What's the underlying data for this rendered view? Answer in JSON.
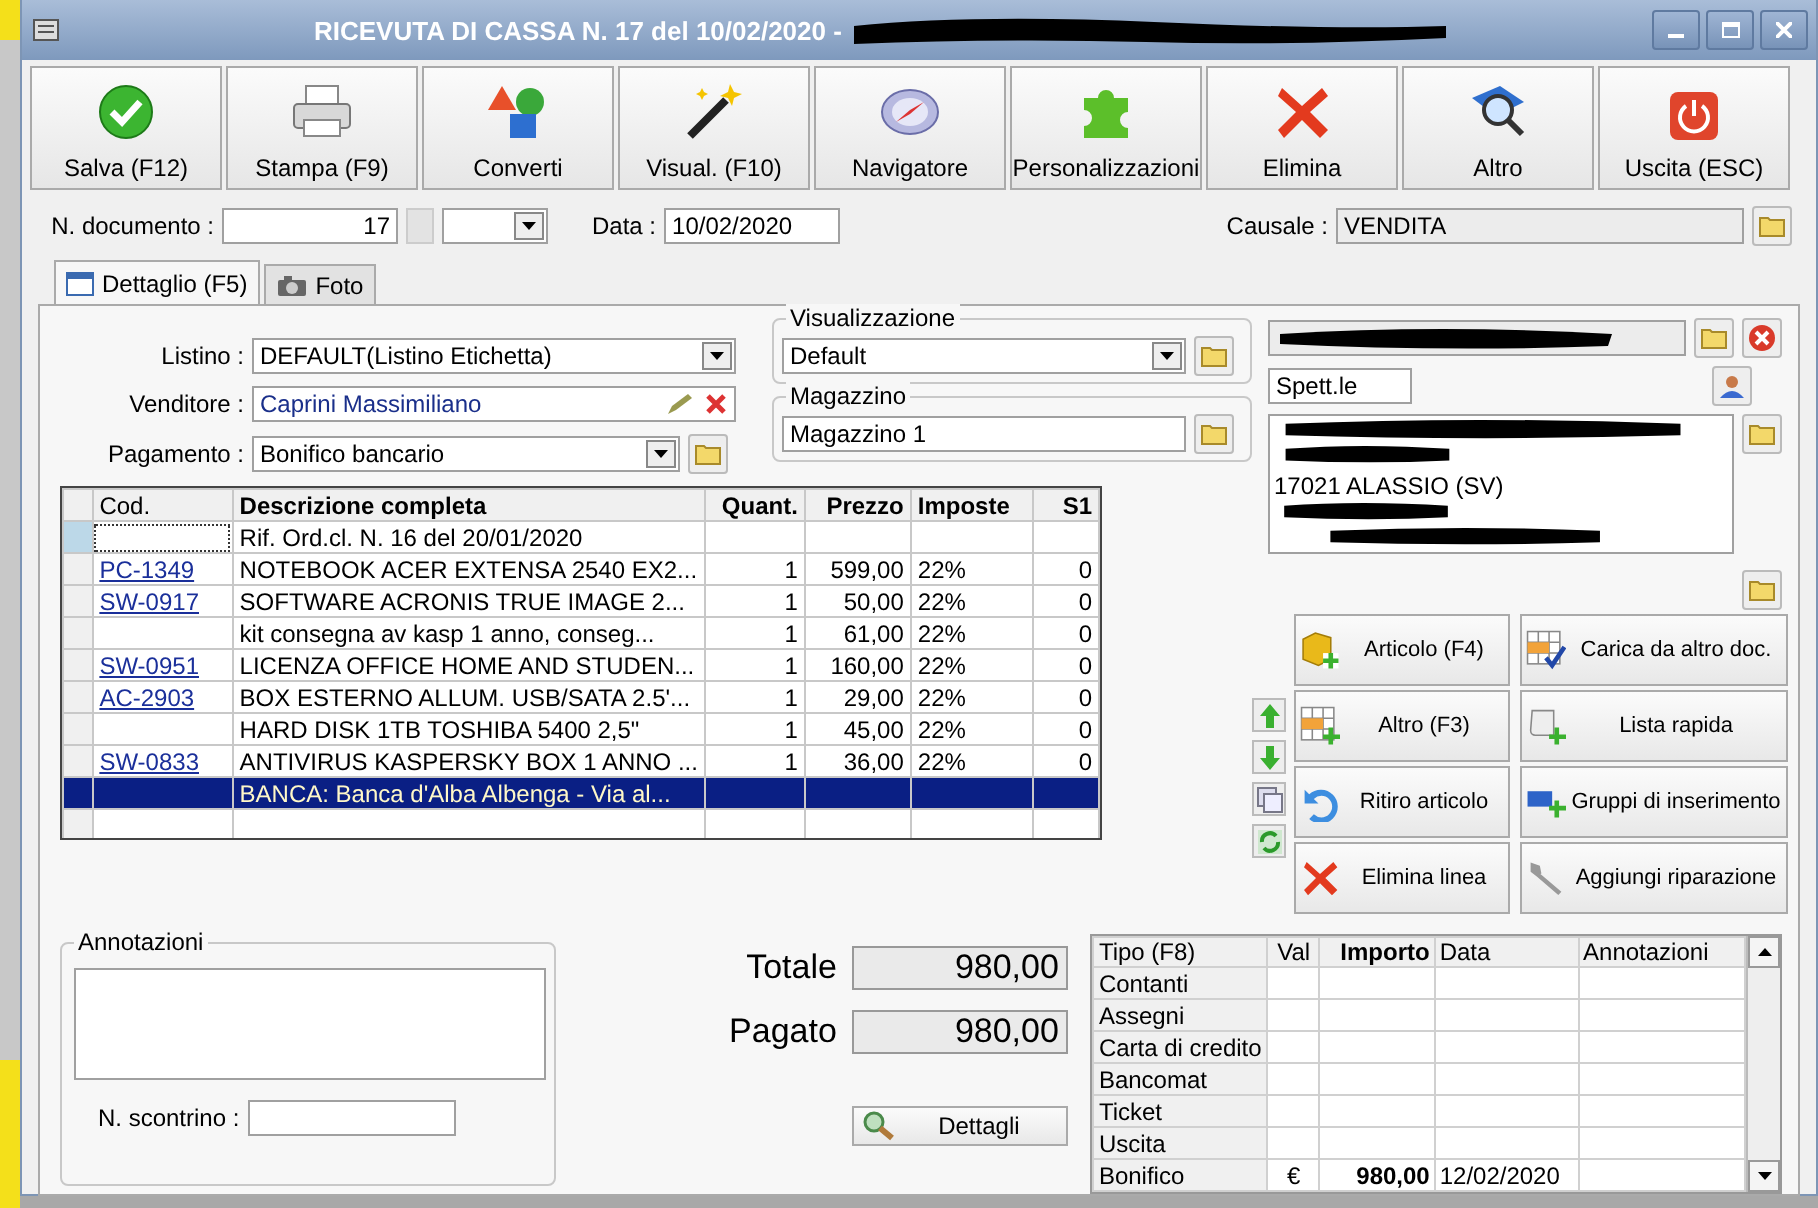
{
  "window": {
    "title": "RICEVUTA DI CASSA N. 17 del 10/02/2020 -"
  },
  "toolbar": [
    {
      "label": "Salva (F12)"
    },
    {
      "label": "Stampa (F9)"
    },
    {
      "label": "Converti"
    },
    {
      "label": "Visual. (F10)"
    },
    {
      "label": "Navigatore"
    },
    {
      "label": "Personalizzazioni"
    },
    {
      "label": "Elimina"
    },
    {
      "label": "Altro"
    },
    {
      "label": "Uscita (ESC)"
    }
  ],
  "header": {
    "doc_label": "N. documento :",
    "doc_number": "17",
    "date_label": "Data :",
    "date": "10/02/2020",
    "reason_label": "Causale :",
    "reason": "VENDITA"
  },
  "tabs": [
    {
      "label": "Dettaglio (F5)",
      "selected": true
    },
    {
      "label": "Foto",
      "selected": false
    }
  ],
  "form": {
    "price_list_label": "Listino :",
    "price_list": "DEFAULT(Listino Etichetta)",
    "seller_label": "Venditore :",
    "seller": "Caprini Massimiliano",
    "payment_label": "Pagamento :",
    "payment": "Bonifico bancario",
    "view_label": "Visualizzazione",
    "view": "Default",
    "warehouse_label": "Magazzino",
    "warehouse": "Magazzino 1"
  },
  "table": {
    "columns": [
      "Cod.",
      "Descrizione completa",
      "Quant.",
      "Prezzo",
      "Imposte",
      "S1"
    ],
    "rows": [
      {
        "description": "Rif. Ord.cl. N. 16 del 20/01/2020",
        "current": true,
        "selected": false
      },
      {
        "code": "PC-1349",
        "description": "NOTEBOOK ACER EXTENSA 2540 EX2...",
        "quantity": "1",
        "price": "599,00",
        "tax": "22%",
        "s1": "0",
        "current": false,
        "selected": false
      },
      {
        "code": "SW-0917",
        "description": "SOFTWARE ACRONIS TRUE IMAGE 2...",
        "quantity": "1",
        "price": "50,00",
        "tax": "22%",
        "s1": "0",
        "current": false,
        "selected": false
      },
      {
        "description": "kit consegna av kasp 1 anno, conseg...",
        "quantity": "1",
        "price": "61,00",
        "tax": "22%",
        "s1": "0",
        "current": false,
        "selected": false
      },
      {
        "code": "SW-0951",
        "description": "LICENZA OFFICE HOME AND STUDEN...",
        "quantity": "1",
        "price": "160,00",
        "tax": "22%",
        "s1": "0",
        "current": false,
        "selected": false
      },
      {
        "code": "AC-2903",
        "description": "BOX ESTERNO ALLUM. USB/SATA 2.5'...",
        "quantity": "1",
        "price": "29,00",
        "tax": "22%",
        "s1": "0",
        "current": false,
        "selected": false
      },
      {
        "description": "HARD DISK 1TB TOSHIBA 5400 2,5\"",
        "quantity": "1",
        "price": "45,00",
        "tax": "22%",
        "s1": "0",
        "current": false,
        "selected": false
      },
      {
        "code": "SW-0833",
        "description": "ANTIVIRUS KASPERSKY BOX 1 ANNO ...",
        "quantity": "1",
        "price": "36,00",
        "tax": "22%",
        "s1": "0",
        "current": false,
        "selected": false
      },
      {
        "description": "BANCA:  Banca d'Alba Albenga - Via al...",
        "current": false,
        "selected": true
      }
    ]
  },
  "customer": {
    "title": "Spett.le",
    "address_line": "17021 ALASSIO (SV)"
  },
  "actions": [
    {
      "label": "Articolo (F4)"
    },
    {
      "label": "Carica da altro doc."
    },
    {
      "label": "Altro (F3)"
    },
    {
      "label": "Lista rapida"
    },
    {
      "label": "Ritiro articolo"
    },
    {
      "label": "Gruppi di inserimento"
    },
    {
      "label": "Elimina linea"
    },
    {
      "label": "Aggiungi riparazione"
    }
  ],
  "notes": {
    "label": "Annotazioni",
    "receipt_label": "N. scontrino :"
  },
  "totals": {
    "total_label": "Totale",
    "total": "980,00",
    "paid_label": "Pagato",
    "paid": "980,00",
    "details_button": "Dettagli"
  },
  "payments": {
    "columns": [
      "Tipo (F8)",
      "Val",
      "Importo",
      "Data",
      "Annotazioni"
    ],
    "rows": [
      {
        "type": "Contanti"
      },
      {
        "type": "Assegni"
      },
      {
        "type": "Carta di credito"
      },
      {
        "type": "Bancomat"
      },
      {
        "type": "Ticket"
      },
      {
        "type": "Uscita"
      },
      {
        "type": "Bonifico",
        "currency": "€",
        "amount": "980,00",
        "date": "12/02/2020"
      }
    ]
  }
}
